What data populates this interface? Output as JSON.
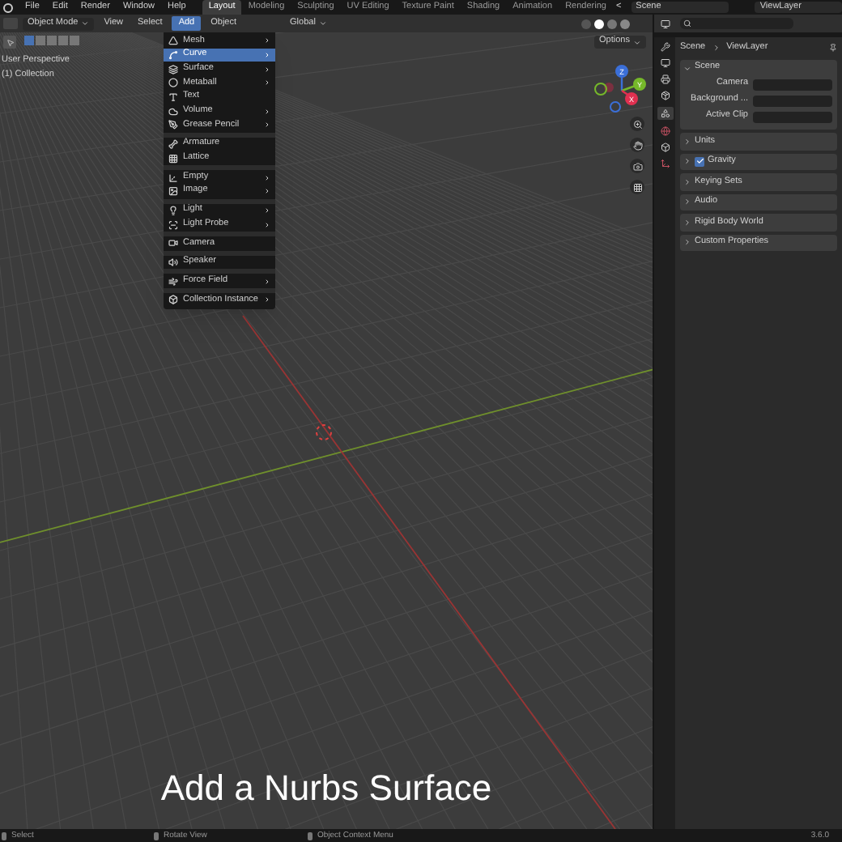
{
  "top_menu": [
    "File",
    "Edit",
    "Render",
    "Window",
    "Help"
  ],
  "workspace_tabs": [
    {
      "label": "Layout",
      "selected": true
    },
    {
      "label": "Modeling",
      "selected": false
    },
    {
      "label": "Sculpting",
      "selected": false
    },
    {
      "label": "UV Editing",
      "selected": false
    },
    {
      "label": "Texture Paint",
      "selected": false
    },
    {
      "label": "Shading",
      "selected": false
    },
    {
      "label": "Animation",
      "selected": false
    },
    {
      "label": "Rendering",
      "selected": false
    }
  ],
  "tabs_scroll": "<",
  "scene_field": "Scene",
  "view_layer_field": "ViewLayer",
  "header": {
    "mode": "Object Mode",
    "menus": [
      {
        "label": "View",
        "selected": false
      },
      {
        "label": "Select",
        "selected": false
      },
      {
        "label": "Add",
        "selected": true
      },
      {
        "label": "Object",
        "selected": false
      }
    ],
    "orientation": "Global"
  },
  "viewport": {
    "options": "Options",
    "overlay_lines": [
      "User Perspective",
      "(1) Collection"
    ],
    "gizmo_axes": [
      "Z",
      "Y",
      "X"
    ],
    "caption": "Add a Nurbs Surface"
  },
  "add_menu": [
    {
      "label": "Mesh",
      "submenu": true,
      "selected": false,
      "separator_before": false
    },
    {
      "label": "Curve",
      "submenu": true,
      "selected": true,
      "separator_before": false
    },
    {
      "label": "Surface",
      "submenu": true,
      "selected": false,
      "separator_before": false
    },
    {
      "label": "Metaball",
      "submenu": true,
      "selected": false,
      "separator_before": false
    },
    {
      "label": "Text",
      "submenu": false,
      "selected": false,
      "separator_before": false
    },
    {
      "label": "Volume",
      "submenu": true,
      "selected": false,
      "separator_before": false
    },
    {
      "label": "Grease Pencil",
      "submenu": true,
      "selected": false,
      "separator_before": false
    },
    {
      "label": "Armature",
      "submenu": false,
      "selected": false,
      "separator_before": true
    },
    {
      "label": "Lattice",
      "submenu": false,
      "selected": false,
      "separator_before": false
    },
    {
      "label": "Empty",
      "submenu": true,
      "selected": false,
      "separator_before": true
    },
    {
      "label": "Image",
      "submenu": true,
      "selected": false,
      "separator_before": false
    },
    {
      "label": "Light",
      "submenu": true,
      "selected": false,
      "separator_before": true
    },
    {
      "label": "Light Probe",
      "submenu": true,
      "selected": false,
      "separator_before": false
    },
    {
      "label": "Camera",
      "submenu": false,
      "selected": false,
      "separator_before": true
    },
    {
      "label": "Speaker",
      "submenu": false,
      "selected": false,
      "separator_before": true
    },
    {
      "label": "Force Field",
      "submenu": true,
      "selected": false,
      "separator_before": true
    },
    {
      "label": "Collection Instance",
      "submenu": true,
      "selected": false,
      "separator_before": true
    }
  ],
  "properties": {
    "breadcrumb": [
      "Scene",
      "ViewLayer"
    ],
    "scene_panel": {
      "title": "Scene",
      "expanded": true,
      "fields": [
        "Camera",
        "Background ...",
        "Active Clip"
      ]
    },
    "panels": [
      {
        "title": "Units",
        "kind": "plain"
      },
      {
        "title": "Gravity",
        "kind": "checkbox",
        "checked": true
      },
      {
        "title": "Keying Sets",
        "kind": "plain"
      },
      {
        "title": "Audio",
        "kind": "plain"
      },
      {
        "title": "Rigid Body World",
        "kind": "plain"
      },
      {
        "title": "Custom Properties",
        "kind": "plain"
      }
    ]
  },
  "status_bar": {
    "hints": [
      "Select",
      "Rotate View",
      "Object Context Menu"
    ],
    "version": "3.6.0"
  }
}
